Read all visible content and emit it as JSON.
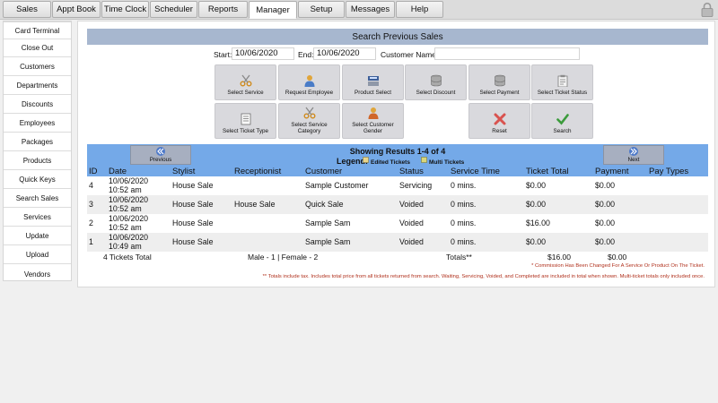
{
  "topnav": {
    "tabs": [
      {
        "label": "Sales",
        "active": false
      },
      {
        "label": "Appt Book",
        "active": false
      },
      {
        "label": "Time Clock",
        "active": false
      },
      {
        "label": "Scheduler",
        "active": false
      },
      {
        "label": "Reports",
        "active": false
      },
      {
        "label": "Manager",
        "active": true
      },
      {
        "label": "Setup",
        "active": false
      },
      {
        "label": "Messages",
        "active": false
      },
      {
        "label": "Help",
        "active": false
      }
    ]
  },
  "sidebar": {
    "items": [
      "Card Terminal",
      "Close Out",
      "Customers",
      "Departments",
      "Discounts",
      "Employees",
      "Packages",
      "Products",
      "Quick Keys",
      "Search Sales",
      "Services",
      "Update",
      "Upload",
      "Vendors"
    ]
  },
  "main": {
    "title": "Search Previous Sales",
    "start_label": "Start:",
    "start_value": "10/06/2020",
    "end_label": "End:",
    "end_value": "10/06/2020",
    "customer_label": "Customer Name:",
    "customer_value": ""
  },
  "filters": {
    "select_service": "Select Service",
    "request_employee": "Request Employee",
    "product_select": "Product Select",
    "select_discount": "Select Discount",
    "select_payment": "Select Payment",
    "select_ticket_status": "Select Ticket Status",
    "select_ticket_type": "Select Ticket Type",
    "select_service_category": "Select Service Category",
    "select_customer_gender": "Select Customer Gender",
    "reset": "Reset",
    "search": "Search"
  },
  "results": {
    "showing": "Showing Results 1-4 of 4",
    "previous_label": "Previous",
    "next_label": "Next",
    "legend_label": "Legend:",
    "legend_edited": "Edited Tickets",
    "legend_multi": "Multi Tickets",
    "columns": [
      "ID",
      "Date",
      "Stylist",
      "Receptionist",
      "Customer",
      "Status",
      "Service Time",
      "Ticket Total",
      "Payment",
      "Pay Types"
    ],
    "rows": [
      {
        "id": "4",
        "date": "10/06/2020",
        "time": "10:52 am",
        "stylist": "House Sale",
        "receptionist": "",
        "customer": "Sample Customer",
        "status": "Servicing",
        "service_time": "0 mins.",
        "ticket_total": "$0.00",
        "payment": "$0.00",
        "pay_types": ""
      },
      {
        "id": "3",
        "date": "10/06/2020",
        "time": "10:52 am",
        "stylist": "House Sale",
        "receptionist": "House Sale",
        "customer": "Quick Sale",
        "status": "Voided",
        "service_time": "0 mins.",
        "ticket_total": "$0.00",
        "payment": "$0.00",
        "pay_types": ""
      },
      {
        "id": "2",
        "date": "10/06/2020",
        "time": "10:52 am",
        "stylist": "House Sale",
        "receptionist": "",
        "customer": "Sample Sam",
        "status": "Voided",
        "service_time": "0 mins.",
        "ticket_total": "$16.00",
        "payment": "$0.00",
        "pay_types": ""
      },
      {
        "id": "1",
        "date": "10/06/2020",
        "time": "10:49 am",
        "stylist": "House Sale",
        "receptionist": "",
        "customer": "Sample Sam",
        "status": "Voided",
        "service_time": "0 mins.",
        "ticket_total": "$0.00",
        "payment": "$0.00",
        "pay_types": ""
      }
    ],
    "row_colors": [
      "#ffffff",
      "#eeeeee"
    ],
    "totals": {
      "tickets": "4 Tickets Total",
      "gender": "Male - 1 | Female - 2",
      "label": "Totals**",
      "ticket_total": "$16.00",
      "payment": "$0.00"
    },
    "note_commission": "* Commission Has Been Changed For A Service Or Product On The Ticket.",
    "note_totals": "** Totals include tax. Includes total price from all tickets returned from search. Waiting, Servicing, Voided, and Completed are included in total when shown. Multi-ticket totals only included once."
  },
  "colors": {
    "title_bar": "#a7b7cf",
    "results_header": "#74a9e8",
    "note_text": "#b0301c"
  }
}
